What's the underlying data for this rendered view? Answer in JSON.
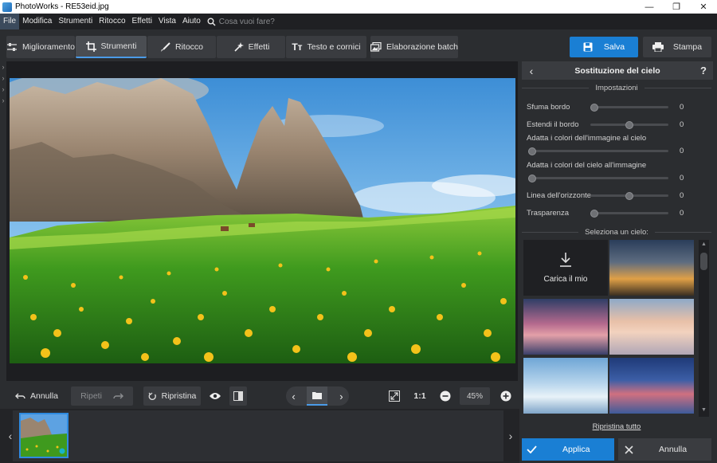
{
  "window": {
    "title": "PhotoWorks - RE53eid.jpg"
  },
  "menu": {
    "items": [
      "File",
      "Modifica",
      "Strumenti",
      "Ritocco",
      "Effetti",
      "Vista",
      "Aiuto"
    ],
    "search_placeholder": "Cosa vuoi fare?"
  },
  "tabs": [
    {
      "label": "Miglioramento",
      "icon": "sliders-icon"
    },
    {
      "label": "Strumenti",
      "icon": "crop-icon",
      "active": true
    },
    {
      "label": "Ritocco",
      "icon": "brush-icon"
    },
    {
      "label": "Effetti",
      "icon": "magic-wand-icon"
    },
    {
      "label": "Testo e cornici",
      "icon": "text-icon"
    },
    {
      "label": "Elaborazione batch",
      "icon": "batch-icon"
    }
  ],
  "toolbar": {
    "save_label": "Salva",
    "print_label": "Stampa"
  },
  "bottom": {
    "undo_label": "Annulla",
    "redo_label": "Ripeti",
    "reset_label": "Ripristina",
    "one_to_one": "1:1",
    "zoom": "45%"
  },
  "panel": {
    "title": "Sostituzione del cielo",
    "help": "?",
    "settings_label": "Impostazioni",
    "sliders": [
      {
        "label": "Sfuma bordo",
        "value": "0",
        "level": 0.0
      },
      {
        "label": "Estendi il bordo",
        "value": "0",
        "level": 0.5
      },
      {
        "label": "Adatta i colori dell'immagine al cielo",
        "value": "0",
        "level": 0.0
      },
      {
        "label": "Adatta i colori del cielo all'immagine",
        "value": "0",
        "level": 0.0
      },
      {
        "label": "Linea dell'orizzonte",
        "value": "0",
        "level": 0.5
      },
      {
        "label": "Trasparenza",
        "value": "0",
        "level": 0.0
      }
    ],
    "select_sky_label": "Seleziona un cielo:",
    "upload_label": "Carica il mio",
    "reset_all_label": "Ripristina tutto",
    "apply_label": "Applica",
    "cancel_label": "Annulla"
  },
  "colors": {
    "accent": "#1a7fd4",
    "panel_bg": "#2b2d30",
    "dark_bg": "#1d1e21"
  }
}
